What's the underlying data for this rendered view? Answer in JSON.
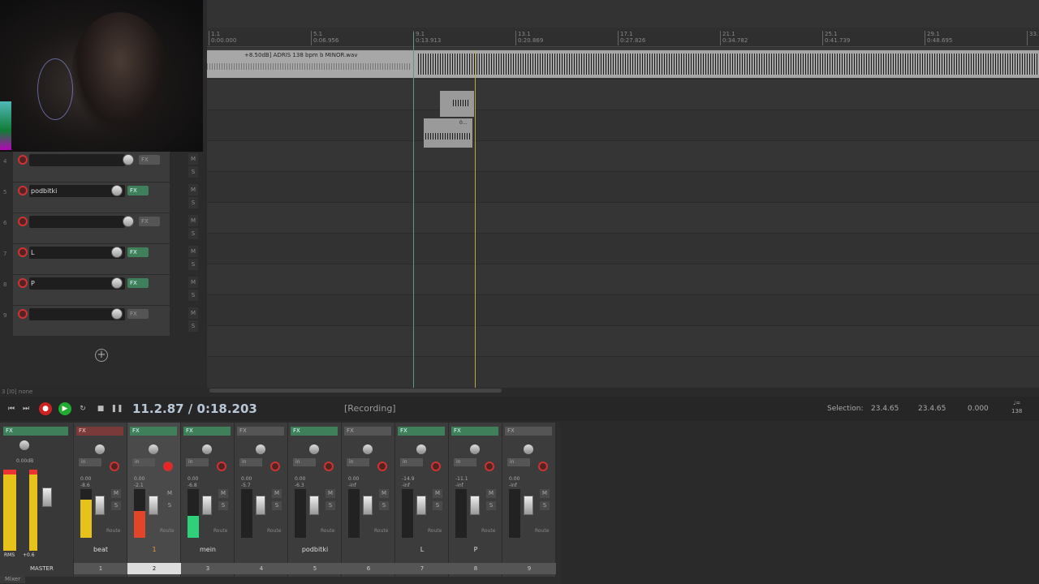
{
  "tracks": [
    {
      "num": "4",
      "name": "",
      "fx_active": false
    },
    {
      "num": "5",
      "name": "podbitki",
      "fx_active": true
    },
    {
      "num": "6",
      "name": "",
      "fx_active": false
    },
    {
      "num": "7",
      "name": "L",
      "fx_active": true
    },
    {
      "num": "8",
      "name": "P",
      "fx_active": true
    },
    {
      "num": "9",
      "name": "",
      "fx_active": false
    }
  ],
  "track_labels": {
    "fx": "FX",
    "mute": "M",
    "solo": "S"
  },
  "status_label": "3 [I0] none",
  "ruler": [
    {
      "bar": "1.1",
      "time": "0:00.000"
    },
    {
      "bar": "5.1",
      "time": "0:06.956"
    },
    {
      "bar": "9.1",
      "time": "0:13.913"
    },
    {
      "bar": "13.1",
      "time": "0:20.869"
    },
    {
      "bar": "17.1",
      "time": "0:27.826"
    },
    {
      "bar": "21.1",
      "time": "0:34.782"
    },
    {
      "bar": "25.1",
      "time": "0:41.739"
    },
    {
      "bar": "29.1",
      "time": "0:48.695"
    },
    {
      "bar": "33.1",
      "time": ""
    }
  ],
  "beat_item_label": "+8.50dB] ADRIS 138 bpm b MINOR.wav",
  "small_item_label": "0...",
  "transport": {
    "time": "11.2.87 / 0:18.203",
    "record_status": "[Recording]",
    "selection_label": "Selection:",
    "selection_start": "23.4.65",
    "selection_end": "23.4.65",
    "selection_length": "0.000",
    "bpm": "138"
  },
  "master": {
    "label": "MASTER",
    "volume": "0.00dB",
    "rms": "RMS",
    "peak": "+0.6"
  },
  "mixer_strips": [
    {
      "name": "beat",
      "num": "1",
      "vol": "0.00",
      "peak": "-8.6",
      "fx": "red",
      "armed": false,
      "meter": 0.78,
      "meter_color": "#e6c21a"
    },
    {
      "name": "1",
      "num": "2",
      "vol": "0.00",
      "peak": "-2.1",
      "fx": "on",
      "armed": true,
      "meter": 0.55,
      "meter_color": "#e2452a",
      "selected": true
    },
    {
      "name": "mein",
      "num": "3",
      "vol": "0.00",
      "peak": "-6.8",
      "fx": "on",
      "armed": false,
      "meter": 0.45,
      "meter_color": "#2fd07a"
    },
    {
      "name": "",
      "num": "4",
      "vol": "0.00",
      "peak": "-5.7",
      "fx": "off",
      "armed": false,
      "meter": 0,
      "meter_color": "#2fd07a"
    },
    {
      "name": "podbitki",
      "num": "5",
      "vol": "0.00",
      "peak": "-6.3",
      "fx": "on",
      "armed": false,
      "meter": 0,
      "meter_color": "#2fd07a"
    },
    {
      "name": "",
      "num": "6",
      "vol": "0.00",
      "peak": "-inf",
      "fx": "off",
      "armed": false,
      "meter": 0,
      "meter_color": "#2fd07a"
    },
    {
      "name": "L",
      "num": "7",
      "vol": "-14.9",
      "peak": "-inf",
      "fx": "on",
      "armed": false,
      "meter": 0,
      "meter_color": "#2fd07a"
    },
    {
      "name": "P",
      "num": "8",
      "vol": "-11.1",
      "peak": "-inf",
      "fx": "on",
      "armed": false,
      "meter": 0,
      "meter_color": "#2fd07a"
    },
    {
      "name": "",
      "num": "9",
      "vol": "0.00",
      "peak": "-inf",
      "fx": "off",
      "armed": false,
      "meter": 0,
      "meter_color": "#2fd07a"
    }
  ],
  "mixer_labels": {
    "in": "in",
    "route": "Route",
    "fx": "FX"
  },
  "mixer_tab": "Mixer"
}
